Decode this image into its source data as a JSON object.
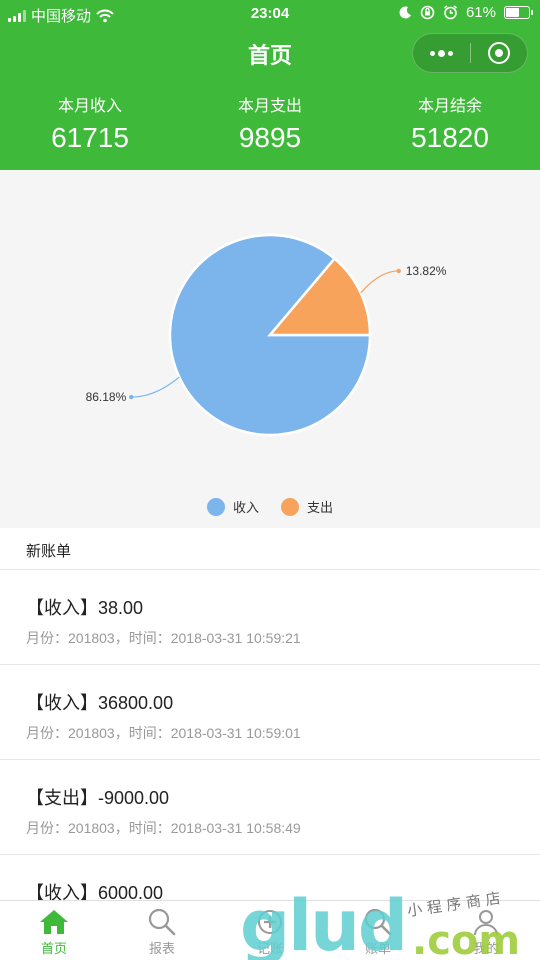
{
  "status": {
    "carrier": "中国移动",
    "time": "23:04",
    "battery": "61%",
    "battery_level": 0.61
  },
  "nav": {
    "title": "首页"
  },
  "summary": [
    {
      "label": "本月收入",
      "value": "61715"
    },
    {
      "label": "本月支出",
      "value": "9895"
    },
    {
      "label": "本月结余",
      "value": "51820"
    }
  ],
  "chart_data": {
    "type": "pie",
    "series": [
      {
        "name": "收入",
        "value": 86.18,
        "label": "86.18%",
        "color": "#7cb5ec"
      },
      {
        "name": "支出",
        "value": 13.82,
        "label": "13.82%",
        "color": "#f7a35c"
      }
    ],
    "legend_position": "bottom"
  },
  "list": {
    "title": "新账单",
    "items": [
      {
        "amount": "【收入】38.00",
        "meta": "月份：201803，时间：2018-03-31 10:59:21"
      },
      {
        "amount": "【收入】36800.00",
        "meta": "月份：201803，时间：2018-03-31 10:59:01"
      },
      {
        "amount": "【支出】-9000.00",
        "meta": "月份：201803，时间：2018-03-31 10:58:49"
      },
      {
        "amount": "【收入】6000.00",
        "meta": ""
      }
    ]
  },
  "tabbar": [
    {
      "label": "首页",
      "icon": "home-icon",
      "active": true
    },
    {
      "label": "报表",
      "icon": "search-icon",
      "active": false
    },
    {
      "label": "记账",
      "icon": "plus-icon",
      "active": false
    },
    {
      "label": "账单",
      "icon": "search-icon",
      "active": false
    },
    {
      "label": "我的",
      "icon": "user-icon",
      "active": false
    }
  ],
  "watermark": {
    "text": "glud.com",
    "subtitle": "小程序商店"
  },
  "colors": {
    "brand": "#3fb93a",
    "income": "#7cb5ec",
    "expense": "#f7a35c"
  }
}
